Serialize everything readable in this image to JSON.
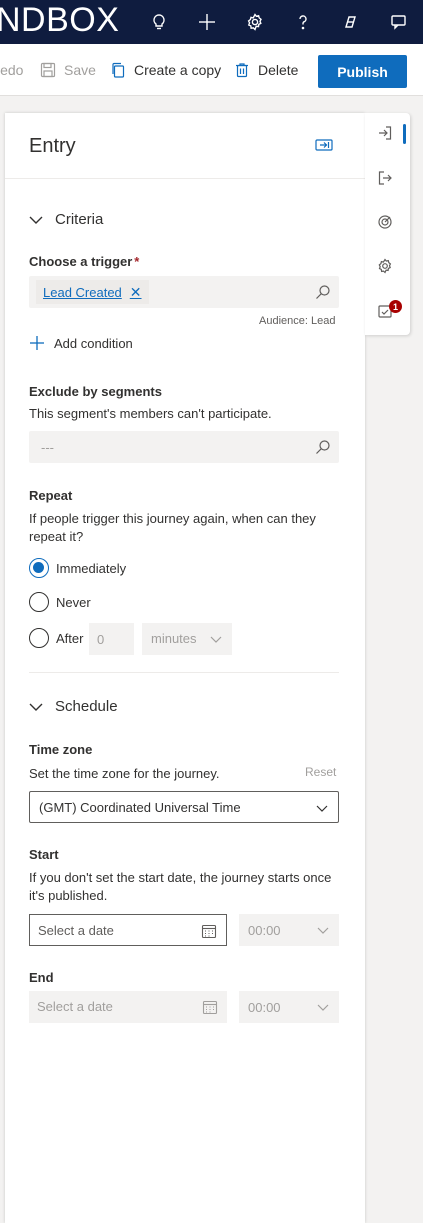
{
  "topbar": {
    "brand": "NDBOX",
    "icons": [
      "lightbulb-icon",
      "plus-icon",
      "gear-icon",
      "help-icon",
      "copilot-icon",
      "feedback-icon"
    ]
  },
  "commandbar": {
    "redo_label": "Redo",
    "save_label": "Save",
    "copy_label": "Create a copy",
    "delete_label": "Delete",
    "publish_label": "Publish"
  },
  "panel": {
    "title": "Entry",
    "criteria": {
      "heading": "Criteria",
      "trigger_label": "Choose a trigger",
      "required_mark": "*",
      "trigger_tag": "Lead Created",
      "tag_remove": "✕",
      "audience": "Audience: Lead",
      "add_condition": "Add condition",
      "exclude_label": "Exclude by segments",
      "exclude_desc": "This segment's members can't participate.",
      "exclude_placeholder": "---",
      "repeat_label": "Repeat",
      "repeat_desc": "If people trigger this journey again, when can they repeat it?",
      "options": [
        {
          "label": "Immediately",
          "selected": true
        },
        {
          "label": "Never",
          "selected": false
        },
        {
          "label": "After",
          "selected": false
        }
      ],
      "after_value": "0",
      "after_unit": "minutes"
    },
    "schedule": {
      "heading": "Schedule",
      "timezone_label": "Time zone",
      "timezone_desc": "Set the time zone for the journey.",
      "reset_label": "Reset",
      "timezone_value": "(GMT) Coordinated Universal Time",
      "start_label": "Start",
      "start_desc": "If you don't set the start date, the journey starts once it's published.",
      "start_date_placeholder": "Select a date",
      "start_time": "00:00",
      "end_label": "End",
      "end_date_placeholder": "Select a date",
      "end_time": "00:00"
    }
  },
  "rail": {
    "items": [
      "entry-icon",
      "exit-icon",
      "goal-icon",
      "settings-icon",
      "validation-icon"
    ],
    "badge_count": "1"
  },
  "colors": {
    "topbar_bg": "#0f1c3f",
    "accent": "#0f6cbd",
    "badge": "#a80000"
  }
}
